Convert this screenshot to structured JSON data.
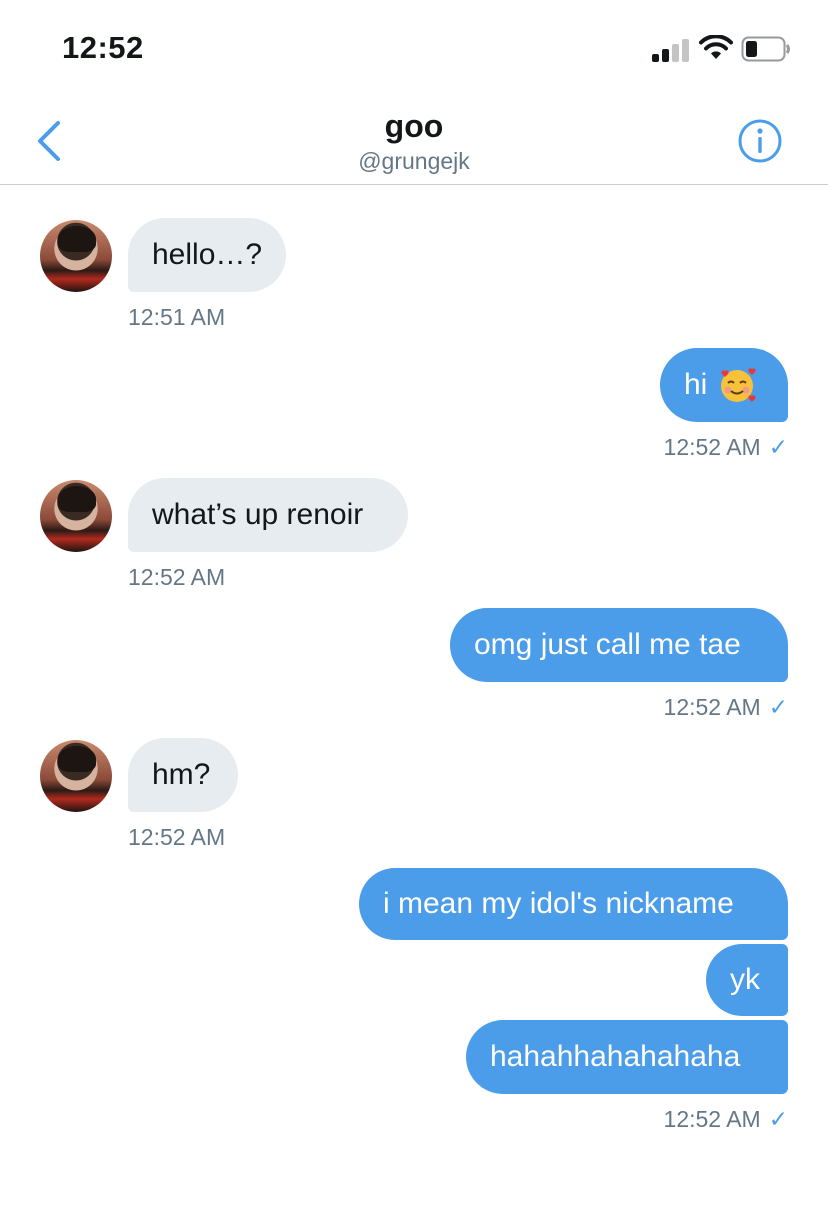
{
  "status_bar": {
    "time": "12:52"
  },
  "header": {
    "name": "goo",
    "handle": "@grungejk"
  },
  "messages": [
    {
      "side": "in",
      "text": "hello…?",
      "time": "12:51 AM"
    },
    {
      "side": "out",
      "text": "hi",
      "emoji": "smiling-face-with-hearts",
      "time": "12:52 AM",
      "check": "✓"
    },
    {
      "side": "in",
      "text": "what’s up renoir",
      "time": "12:52 AM"
    },
    {
      "side": "out",
      "text": "omg just call me tae",
      "time": "12:52 AM",
      "check": "✓"
    },
    {
      "side": "in",
      "text": "hm?",
      "time": "12:52 AM"
    },
    {
      "side": "out",
      "text": "i mean my idol's nickname"
    },
    {
      "side": "out",
      "text": "yk"
    },
    {
      "side": "out",
      "text": "hahahhahahahaha",
      "time": "12:52 AM",
      "check": "✓"
    }
  ],
  "colors": {
    "accent": "#4b9de9",
    "incoming_bubble": "#e6ecf0",
    "muted": "#657786"
  }
}
